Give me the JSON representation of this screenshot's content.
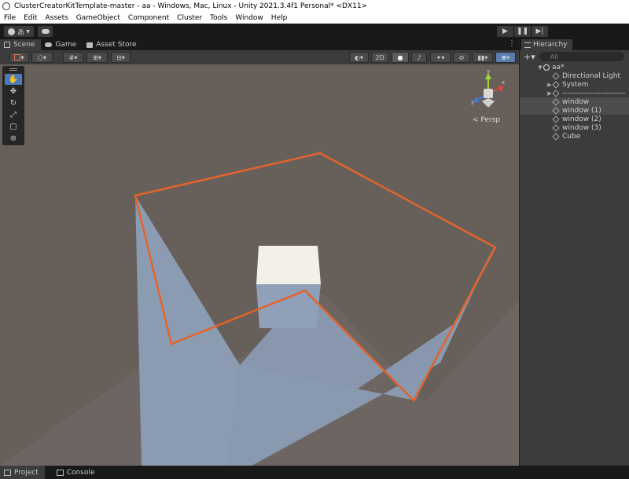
{
  "window": {
    "title": "ClusterCreatorKitTemplate-master - aa - Windows, Mac, Linux - Unity 2021.3.4f1 Personal* <DX11>"
  },
  "menu": [
    "File",
    "Edit",
    "Assets",
    "GameObject",
    "Component",
    "Cluster",
    "Tools",
    "Window",
    "Help"
  ],
  "toolbar": {
    "account_label": "あ",
    "play_icons": [
      "play-icon",
      "pause-icon",
      "step-icon"
    ]
  },
  "tabs": [
    {
      "label": "Scene",
      "icon": "scene-icon",
      "active": true
    },
    {
      "label": "Game",
      "icon": "game-icon",
      "active": false
    },
    {
      "label": "Asset Store",
      "icon": "store-icon",
      "active": false
    }
  ],
  "scene_toolbar": {
    "mode_2d": "2D"
  },
  "gizmo": {
    "y": "y",
    "x": "x",
    "z": "z",
    "view_label": "< Persp"
  },
  "tools": [
    "hand-tool",
    "move-tool",
    "rotate-tool",
    "scale-tool",
    "rect-tool",
    "transform-tool"
  ],
  "hierarchy": {
    "tab_label": "Hierarchy",
    "search_placeholder": "All",
    "scene_name": "aa*",
    "items": [
      {
        "label": "Directional Light",
        "expandable": false,
        "selected": false
      },
      {
        "label": "System",
        "expandable": true,
        "selected": false
      },
      {
        "label": "--------------------------",
        "expandable": true,
        "selected": false
      },
      {
        "label": "window",
        "expandable": false,
        "selected": true
      },
      {
        "label": "window (1)",
        "expandable": false,
        "selected": true
      },
      {
        "label": "window (2)",
        "expandable": false,
        "selected": false
      },
      {
        "label": "window (3)",
        "expandable": false,
        "selected": false
      },
      {
        "label": "Cube",
        "expandable": false,
        "selected": false
      }
    ]
  },
  "bottom_tabs": [
    {
      "label": "Project",
      "active": true
    },
    {
      "label": "Console",
      "active": false
    }
  ],
  "colors": {
    "selection_outline": "#e3642a",
    "scene_bg": "#675f5a",
    "plane_fill": "#8b9bb2",
    "active_tool": "#4b7bbd"
  }
}
